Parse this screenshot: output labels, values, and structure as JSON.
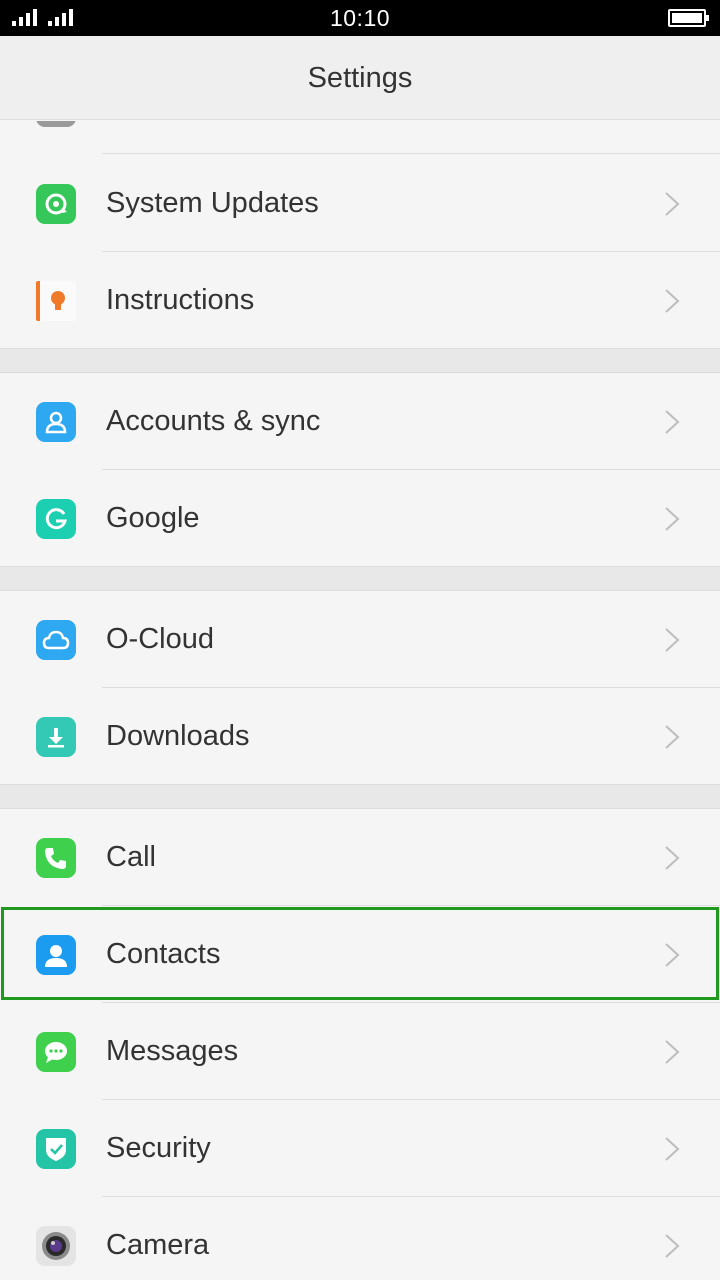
{
  "status_bar": {
    "time": "10:10"
  },
  "header": {
    "title": "Settings"
  },
  "items": [
    {
      "label": "System Updates",
      "icon": "system-updates-icon",
      "color": "#35c759"
    },
    {
      "label": "Instructions",
      "icon": "instructions-icon",
      "color": "#f07a2a"
    },
    {
      "label": "Accounts & sync",
      "icon": "accounts-sync-icon",
      "color": "#2ea8f0"
    },
    {
      "label": "Google",
      "icon": "google-icon",
      "color": "#1ccfb0"
    },
    {
      "label": "O-Cloud",
      "icon": "cloud-icon",
      "color": "#2ea8f0"
    },
    {
      "label": "Downloads",
      "icon": "download-icon",
      "color": "#33c9b4"
    },
    {
      "label": "Call",
      "icon": "phone-icon",
      "color": "#3fd04e"
    },
    {
      "label": "Contacts",
      "icon": "contacts-icon",
      "color": "#1c9cf0"
    },
    {
      "label": "Messages",
      "icon": "messages-icon",
      "color": "#3fd04e"
    },
    {
      "label": "Security",
      "icon": "shield-icon",
      "color": "#24c5a6"
    },
    {
      "label": "Camera",
      "icon": "camera-icon",
      "color": "#8a8a8a"
    }
  ],
  "highlight_color": "#1f9a1f"
}
